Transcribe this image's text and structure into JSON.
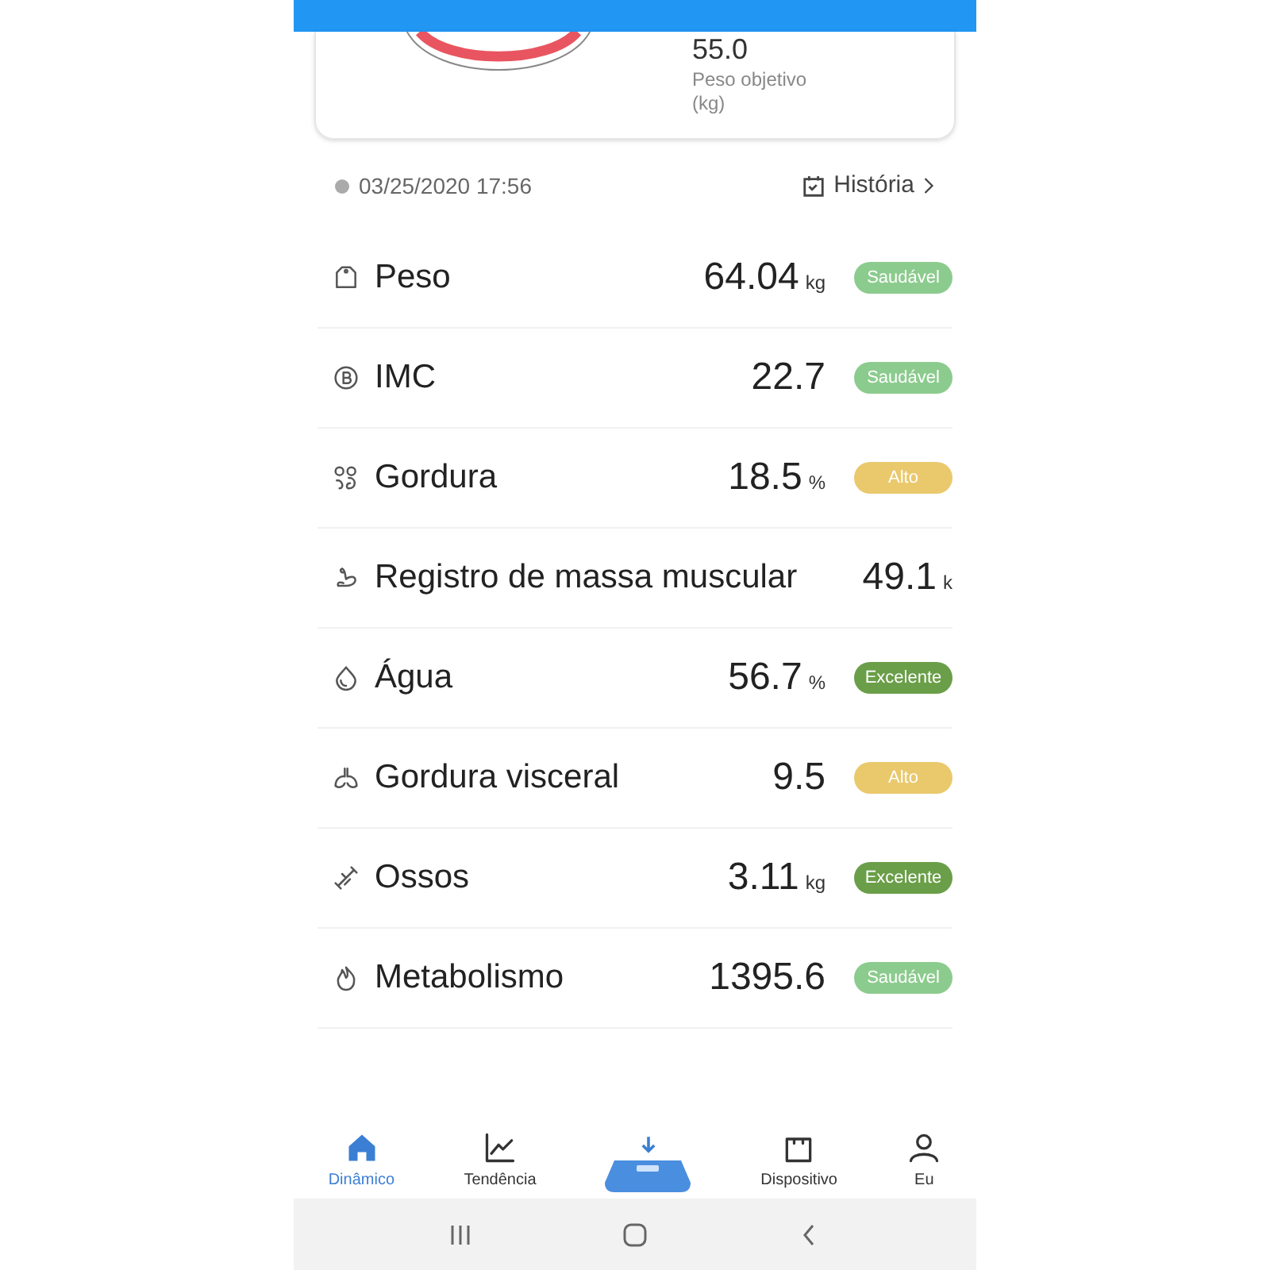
{
  "goal": {
    "value": "55.0",
    "label": "Peso objetivo",
    "unit": "(kg)"
  },
  "measurement": {
    "datetime": "03/25/2020 17:56",
    "history_link": "História"
  },
  "metrics": [
    {
      "name": "Peso",
      "value": "64.04",
      "unit": "kg",
      "status": "Saudável",
      "color": "#8ccb8e"
    },
    {
      "name": "IMC",
      "value": "22.7",
      "status": "Saudável",
      "color": "#8ccb8e"
    },
    {
      "name": "Gordura",
      "value": "18.5",
      "unit": "%",
      "status": "Alto",
      "color": "#eac86c"
    },
    {
      "name": "Registro de massa muscular",
      "value": "49.1",
      "unit": "k"
    },
    {
      "name": "Água",
      "value": "56.7",
      "unit": "%",
      "status": "Excelente",
      "color": "#6a9e48"
    },
    {
      "name": "Gordura visceral",
      "value": "9.5",
      "status": "Alto",
      "color": "#eac86c"
    },
    {
      "name": "Ossos",
      "value": "3.11",
      "unit": "kg",
      "status": "Excelente",
      "color": "#6a9e48"
    },
    {
      "name": "Metabolismo",
      "value": "1395.6",
      "status": "Saudável",
      "color": "#8ccb8e"
    }
  ],
  "bottom_nav": [
    {
      "kind": "tab",
      "label": "Dinâmico",
      "selected": true
    },
    {
      "kind": "tab",
      "label": "Tendência",
      "selected": false
    },
    {
      "kind": "scale",
      "selected": false
    },
    {
      "kind": "tab",
      "label": "Dispositivo",
      "selected": false
    },
    {
      "kind": "tab",
      "label": "Eu",
      "selected": false
    }
  ]
}
